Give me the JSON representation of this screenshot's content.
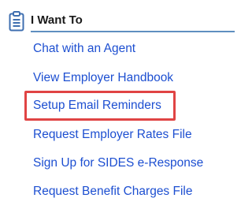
{
  "panel": {
    "header": {
      "icon": "clipboard-icon",
      "title": "I Want To"
    },
    "links": [
      {
        "label": "Chat with an Agent"
      },
      {
        "label": "View Employer Handbook"
      },
      {
        "label": "Setup Email Reminders",
        "highlighted": true
      },
      {
        "label": "Request Employer Rates File"
      },
      {
        "label": "Sign Up for SIDES e-Response"
      },
      {
        "label": "Request Benefit Charges File"
      }
    ]
  },
  "colors": {
    "link": "#1d4fd1",
    "header_rule": "#5f8fc0",
    "icon": "#3f6fb0",
    "highlight": "#e04444"
  }
}
